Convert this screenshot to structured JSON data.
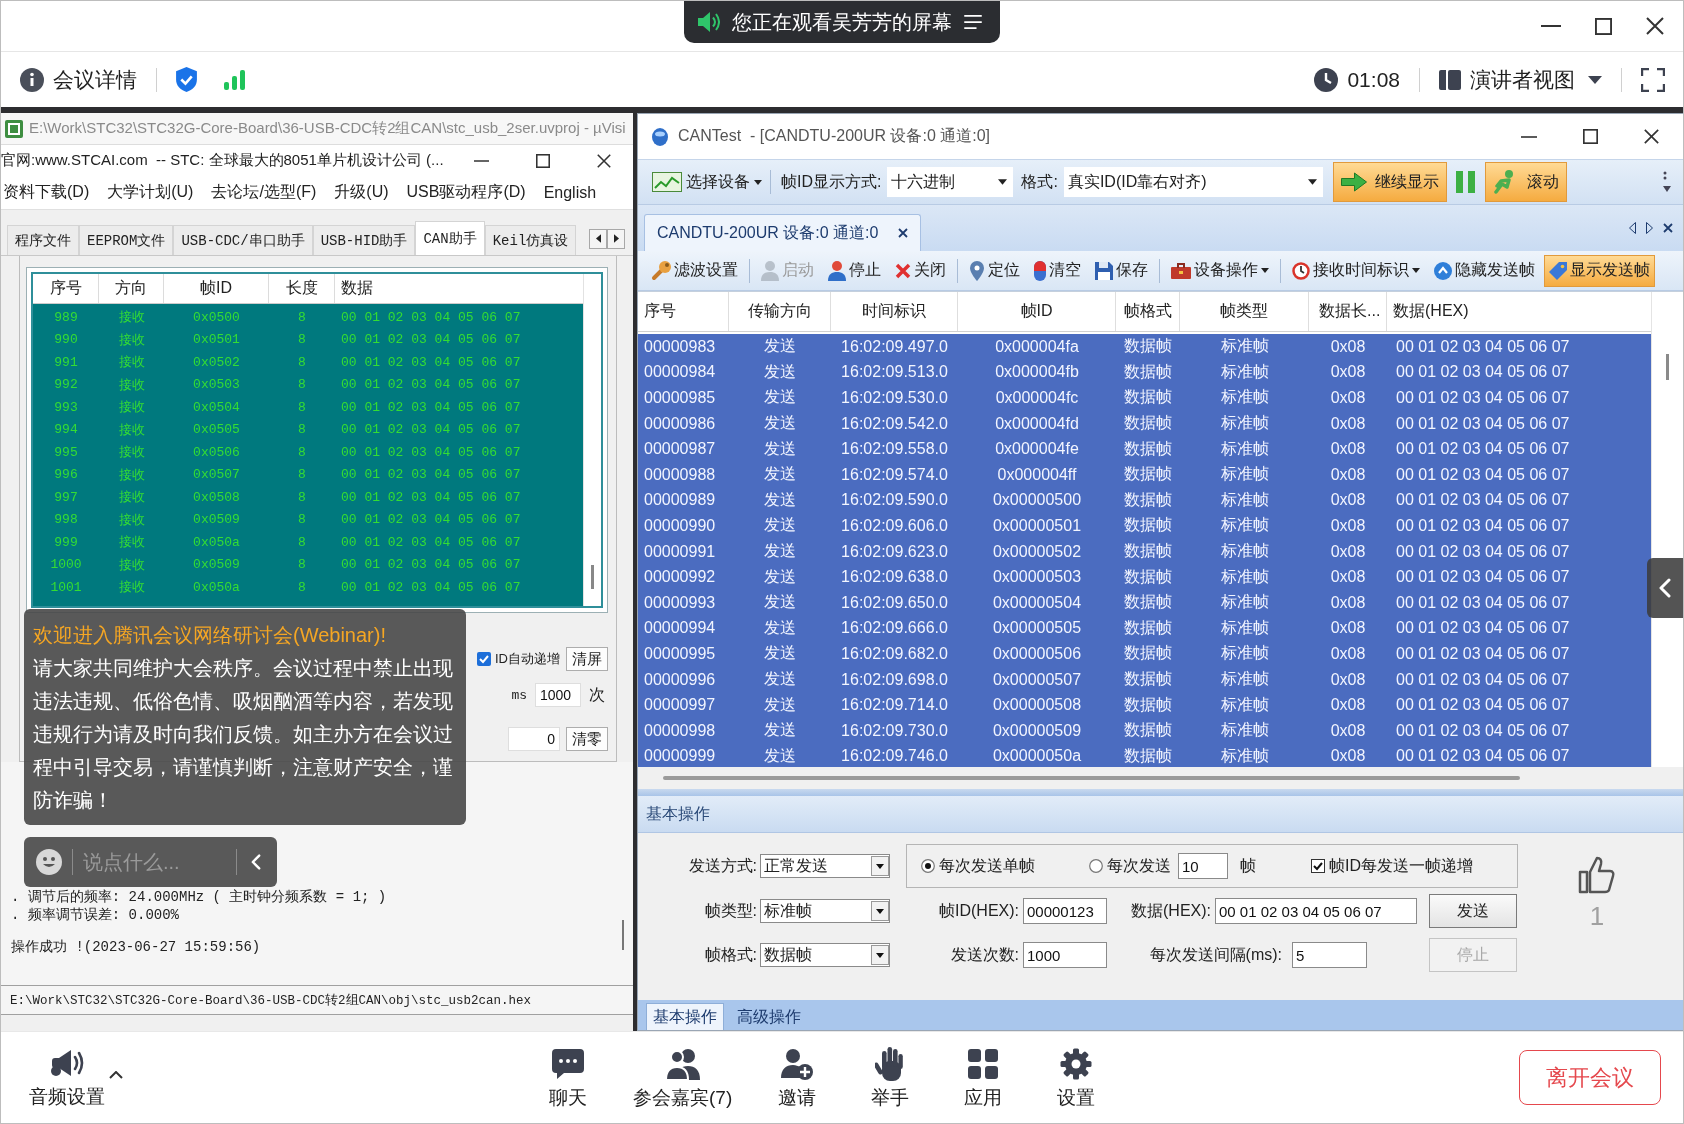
{
  "meeting": {
    "share_banner": "您正在观看吴芳芳的屏幕",
    "info_label": "会议详情",
    "timer": "01:08",
    "view_mode": "演讲者视图"
  },
  "left_window": {
    "background_title": "E:\\Work\\STC32\\STC32G-Core-Board\\36-USB-CDC转2组CAN\\stc_usb_2ser.uvproj - µVisi",
    "title": "官网:www.STCAI.com  -- STC: 全球最大的8051单片机设计公司 (...",
    "menu": [
      "资料下载(D)",
      "大学计划(U)",
      "去论坛/选型(F)",
      "升级(U)",
      "USB驱动程序(D)",
      "English"
    ],
    "tabs": [
      {
        "label": "程序文件",
        "selected": false
      },
      {
        "label": "EEPROM文件",
        "selected": false
      },
      {
        "label": "USB-CDC/串口助手",
        "selected": false
      },
      {
        "label": "USB-HID助手",
        "selected": false
      },
      {
        "label": "CAN助手",
        "selected": true
      },
      {
        "label": "Keil仿真设",
        "selected": false
      }
    ],
    "frame_table": {
      "columns": [
        "序号",
        "方向",
        "帧ID",
        "长度",
        "数据"
      ],
      "rows": [
        [
          "989",
          "接收",
          "0x0500",
          "8",
          "00 01 02 03 04 05 06 07"
        ],
        [
          "990",
          "接收",
          "0x0501",
          "8",
          "00 01 02 03 04 05 06 07"
        ],
        [
          "991",
          "接收",
          "0x0502",
          "8",
          "00 01 02 03 04 05 06 07"
        ],
        [
          "992",
          "接收",
          "0x0503",
          "8",
          "00 01 02 03 04 05 06 07"
        ],
        [
          "993",
          "接收",
          "0x0504",
          "8",
          "00 01 02 03 04 05 06 07"
        ],
        [
          "994",
          "接收",
          "0x0505",
          "8",
          "00 01 02 03 04 05 06 07"
        ],
        [
          "995",
          "接收",
          "0x0506",
          "8",
          "00 01 02 03 04 05 06 07"
        ],
        [
          "996",
          "接收",
          "0x0507",
          "8",
          "00 01 02 03 04 05 06 07"
        ],
        [
          "997",
          "接收",
          "0x0508",
          "8",
          "00 01 02 03 04 05 06 07"
        ],
        [
          "998",
          "接收",
          "0x0509",
          "8",
          "00 01 02 03 04 05 06 07"
        ],
        [
          "999",
          "接收",
          "0x050a",
          "8",
          "00 01 02 03 04 05 06 07"
        ],
        [
          "1000",
          "接收",
          "0x0509",
          "8",
          "00 01 02 03 04 05 06 07"
        ],
        [
          "1001",
          "接收",
          "0x050a",
          "8",
          "00 01 02 03 04 05 06 07"
        ]
      ]
    },
    "controls": {
      "auto_increment": {
        "label": "ID自动递增",
        "checked": true
      },
      "clear_screen": "清屏",
      "interval_unit": "ms",
      "repeat_count": "1000",
      "repeat_unit": "次",
      "frame_counter": "0",
      "reset_counter": "清零"
    },
    "log": [
      ". 调节后的频率: 24.000MHz ( 主时钟分频系数 = 1; )",
      ". 频率调节误差: 0.000%",
      "操作成功 !(2023-06-27 15:59:56)"
    ],
    "hex_path": "E:\\Work\\STC32\\STC32G-Core-Board\\36-USB-CDC转2组CAN\\obj\\stc_usb2can.hex"
  },
  "right_window": {
    "title": "CANTest  - [CANDTU-200UR 设备:0 通道:0]",
    "toolbar": {
      "device_menu": "选择设备",
      "id_display": {
        "label": "帧ID显示方式:",
        "value": "十六进制"
      },
      "format": {
        "label": "格式:",
        "value": "真实ID(ID靠右对齐)"
      },
      "toggles": [
        {
          "label": "继续显示",
          "on": true
        },
        {
          "label": "滚动",
          "on": true
        }
      ]
    },
    "document_tabs": [
      {
        "label": "CANDTU-200UR 设备:0 通道:0",
        "selected": true
      }
    ],
    "actions": [
      [
        {
          "label": "滤波设置",
          "disabled": false,
          "on": false,
          "menu": false
        }
      ],
      [
        {
          "label": "启动",
          "disabled": true,
          "on": false,
          "menu": false
        },
        {
          "label": "停止",
          "disabled": false,
          "on": false,
          "menu": false
        },
        {
          "label": "关闭",
          "disabled": false,
          "on": false,
          "menu": false
        }
      ],
      [
        {
          "label": "定位",
          "disabled": false,
          "on": false,
          "menu": false
        },
        {
          "label": "清空",
          "disabled": false,
          "on": false,
          "menu": false
        },
        {
          "label": "保存",
          "disabled": false,
          "on": false,
          "menu": false
        }
      ],
      [
        {
          "label": "设备操作",
          "disabled": false,
          "on": false,
          "menu": true
        }
      ],
      [
        {
          "label": "接收时间标识",
          "disabled": false,
          "on": false,
          "menu": true
        },
        {
          "label": "隐藏发送帧",
          "disabled": false,
          "on": false,
          "menu": false
        },
        {
          "label": "显示发送帧",
          "disabled": false,
          "on": true,
          "menu": false
        }
      ]
    ],
    "table": {
      "columns": [
        "序号",
        "传输方向",
        "时间标识",
        "帧ID",
        "帧格式",
        "帧类型",
        "数据长...",
        "数据(HEX)"
      ],
      "rows": [
        {
          "cells": [
            "00000983",
            "发送",
            "16:02:09.497.0",
            "0x000004fa",
            "数据帧",
            "标准帧",
            "0x08",
            "00 01 02 03 04 05 06 07"
          ],
          "selected": true
        },
        {
          "cells": [
            "00000984",
            "发送",
            "16:02:09.513.0",
            "0x000004fb",
            "数据帧",
            "标准帧",
            "0x08",
            "00 01 02 03 04 05 06 07"
          ],
          "selected": true
        },
        {
          "cells": [
            "00000985",
            "发送",
            "16:02:09.530.0",
            "0x000004fc",
            "数据帧",
            "标准帧",
            "0x08",
            "00 01 02 03 04 05 06 07"
          ],
          "selected": true
        },
        {
          "cells": [
            "00000986",
            "发送",
            "16:02:09.542.0",
            "0x000004fd",
            "数据帧",
            "标准帧",
            "0x08",
            "00 01 02 03 04 05 06 07"
          ],
          "selected": true
        },
        {
          "cells": [
            "00000987",
            "发送",
            "16:02:09.558.0",
            "0x000004fe",
            "数据帧",
            "标准帧",
            "0x08",
            "00 01 02 03 04 05 06 07"
          ],
          "selected": true
        },
        {
          "cells": [
            "00000988",
            "发送",
            "16:02:09.574.0",
            "0x000004ff",
            "数据帧",
            "标准帧",
            "0x08",
            "00 01 02 03 04 05 06 07"
          ],
          "selected": true
        },
        {
          "cells": [
            "00000989",
            "发送",
            "16:02:09.590.0",
            "0x00000500",
            "数据帧",
            "标准帧",
            "0x08",
            "00 01 02 03 04 05 06 07"
          ],
          "selected": true
        },
        {
          "cells": [
            "00000990",
            "发送",
            "16:02:09.606.0",
            "0x00000501",
            "数据帧",
            "标准帧",
            "0x08",
            "00 01 02 03 04 05 06 07"
          ],
          "selected": true
        },
        {
          "cells": [
            "00000991",
            "发送",
            "16:02:09.623.0",
            "0x00000502",
            "数据帧",
            "标准帧",
            "0x08",
            "00 01 02 03 04 05 06 07"
          ],
          "selected": true
        },
        {
          "cells": [
            "00000992",
            "发送",
            "16:02:09.638.0",
            "0x00000503",
            "数据帧",
            "标准帧",
            "0x08",
            "00 01 02 03 04 05 06 07"
          ],
          "selected": true
        },
        {
          "cells": [
            "00000993",
            "发送",
            "16:02:09.650.0",
            "0x00000504",
            "数据帧",
            "标准帧",
            "0x08",
            "00 01 02 03 04 05 06 07"
          ],
          "selected": true
        },
        {
          "cells": [
            "00000994",
            "发送",
            "16:02:09.666.0",
            "0x00000505",
            "数据帧",
            "标准帧",
            "0x08",
            "00 01 02 03 04 05 06 07"
          ],
          "selected": true
        },
        {
          "cells": [
            "00000995",
            "发送",
            "16:02:09.682.0",
            "0x00000506",
            "数据帧",
            "标准帧",
            "0x08",
            "00 01 02 03 04 05 06 07"
          ],
          "selected": true
        },
        {
          "cells": [
            "00000996",
            "发送",
            "16:02:09.698.0",
            "0x00000507",
            "数据帧",
            "标准帧",
            "0x08",
            "00 01 02 03 04 05 06 07"
          ],
          "selected": true
        },
        {
          "cells": [
            "00000997",
            "发送",
            "16:02:09.714.0",
            "0x00000508",
            "数据帧",
            "标准帧",
            "0x08",
            "00 01 02 03 04 05 06 07"
          ],
          "selected": true
        },
        {
          "cells": [
            "00000998",
            "发送",
            "16:02:09.730.0",
            "0x00000509",
            "数据帧",
            "标准帧",
            "0x08",
            "00 01 02 03 04 05 06 07"
          ],
          "selected": true
        },
        {
          "cells": [
            "00000999",
            "发送",
            "16:02:09.746.0",
            "0x0000050a",
            "数据帧",
            "标准帧",
            "0x08",
            "00 01 02 03 04 05 06 07"
          ],
          "selected": true
        }
      ]
    },
    "send_panel": {
      "title": "基本操作",
      "send_mode": {
        "label": "发送方式:",
        "value": "正常发送"
      },
      "frame_type": {
        "label": "帧类型:",
        "value": "标准帧"
      },
      "frame_format": {
        "label": "帧格式:",
        "value": "数据帧"
      },
      "send_options": [
        {
          "kind": "single",
          "label": "每次发送单帧",
          "selected": true
        },
        {
          "kind": "batch",
          "label": "每次发送",
          "selected": false,
          "count": "10",
          "unit": "帧"
        }
      ],
      "id_increment": {
        "label": "帧ID每发送一帧递增",
        "checked": true
      },
      "frame_id": {
        "label": "帧ID(HEX):",
        "value": "00000123"
      },
      "data": {
        "label": "数据(HEX):",
        "value": "00 01 02 03 04 05 06 07"
      },
      "send_count": {
        "label": "发送次数:",
        "value": "1000"
      },
      "interval": {
        "label": "每次发送间隔(ms):",
        "value": "5"
      },
      "send_button": {
        "label": "发送",
        "disabled": false
      },
      "stop_button": {
        "label": "停止",
        "disabled": true
      }
    },
    "panel_tabs": [
      {
        "label": "基本操作",
        "selected": true
      },
      {
        "label": "高级操作",
        "selected": false
      }
    ]
  },
  "chat": {
    "welcome": "欢迎进入腾讯会议网络研讨会(Webinar)!",
    "notice": "请大家共同维护大会秩序。会议过程中禁止出现违法违规、低俗色情、吸烟酗酒等内容，若发现违规行为请及时向我们反馈。如主办方在会议过程中引导交易，请谨慎判断，注意财产安全，谨防诈骗！",
    "input": {
      "placeholder": "说点什么..."
    }
  },
  "reaction": {
    "count": "1"
  },
  "bottom_bar": {
    "audio": "音频设置",
    "items": [
      "聊天",
      "参会嘉宾(7)",
      "邀请",
      "举手",
      "应用",
      "设置"
    ],
    "leave": "离开会议"
  }
}
